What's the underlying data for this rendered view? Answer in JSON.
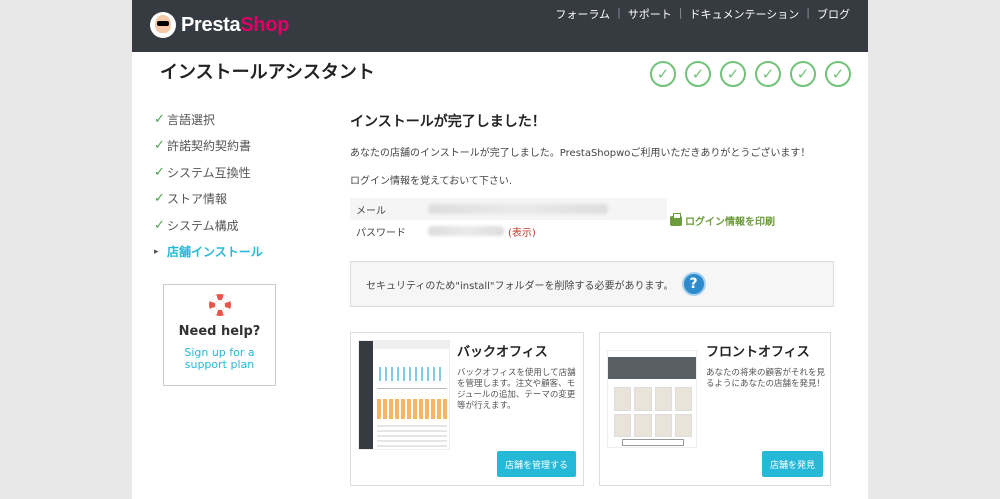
{
  "header": {
    "logo_presta": "Presta",
    "logo_shop": "Shop",
    "nav": [
      "フォーラム",
      "サポート",
      "ドキュメンテーション",
      "ブログ"
    ],
    "separator": "|"
  },
  "title": "インストールアシスタント",
  "steps_check": "✓",
  "sidebar": {
    "items": [
      {
        "label": "言語選択",
        "mark": "✓"
      },
      {
        "label": "許諾契約契約書",
        "mark": "✓"
      },
      {
        "label": "システム互換性",
        "mark": "✓"
      },
      {
        "label": "ストア情報",
        "mark": "✓"
      },
      {
        "label": "システム構成",
        "mark": "✓"
      },
      {
        "label": "店舗インストール",
        "mark": "▸"
      }
    ]
  },
  "help": {
    "title": "Need help?",
    "link": "Sign up for a support plan"
  },
  "main": {
    "heading": "インストールが完了しました！",
    "message": "あなたの店舗のインストールが完了しました。PrestaShopwoご利用いただきありがとうございます！",
    "reminder": "ログイン情報を覚えておいて下さい.",
    "email_label": "メール",
    "password_label": "パスワード",
    "show_link": "(表示)",
    "print_label": "ログイン情報を印刷",
    "alert": "セキュリティのため\"install\"フォルダーを削除する必要があります。",
    "alert_icon": "?"
  },
  "cards": {
    "back": {
      "title": "バックオフィス",
      "desc": "バックオフィスを使用して店舗を管理します。注文や顧客、モジュールの追加、テーマの変更等が行えます。",
      "button": "店舗を管理する"
    },
    "front": {
      "title": "フロントオフィス",
      "desc": "あなたの将来の顧客がそれを見るようにあなたの店舗を発見！",
      "button": "店舗を発見"
    }
  }
}
